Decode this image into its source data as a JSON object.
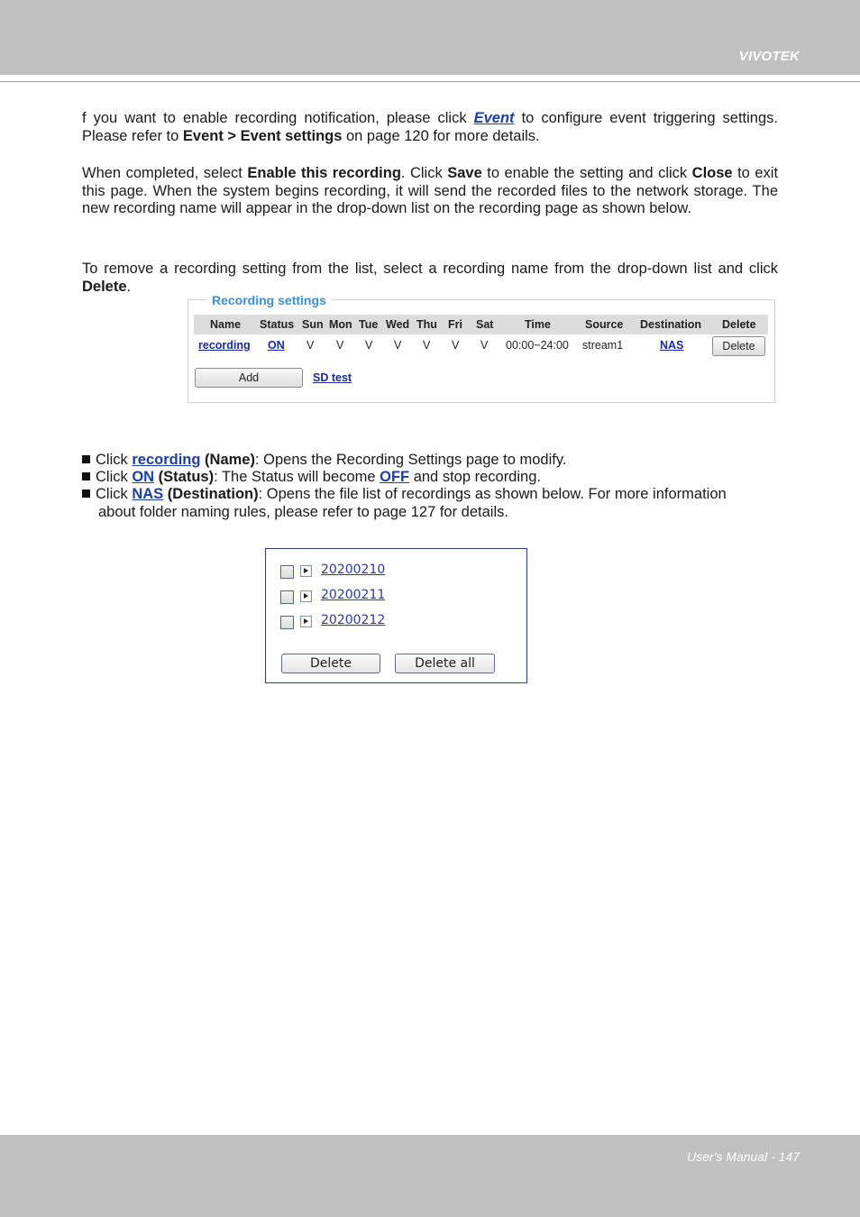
{
  "header": {
    "brand": "VIVOTEK"
  },
  "footer": {
    "text": "User's Manual - 147"
  },
  "paragraphs": {
    "p1": {
      "t1": "f you want to enable recording notification, please click ",
      "link": "Event",
      "t2": " to configure event triggering settings. Please refer to ",
      "b1": "Event > Event settings",
      "t3": " on page 120 for more details."
    },
    "p2": {
      "t1": "When completed, select ",
      "b1": "Enable this recording",
      "t2": ". Click ",
      "b2": "Save",
      "t3": " to enable the setting and click ",
      "b3": "Close",
      "t4": " to exit this page. When the system begins recording, it will send the recorded files to the network storage. The new recording name will appear in the drop-down list on the recording page as shown below."
    },
    "p3": {
      "t1": "To remove a recording setting from the list, select a recording name from the drop-down list and click ",
      "b1": "Delete",
      "t2": "."
    }
  },
  "recording_settings": {
    "legend": "Recording settings",
    "columns": [
      "Name",
      "Status",
      "Sun",
      "Mon",
      "Tue",
      "Wed",
      "Thu",
      "Fri",
      "Sat",
      "Time",
      "Source",
      "Destination",
      "Delete"
    ],
    "row": {
      "name": "recording",
      "status": "ON",
      "days": [
        "V",
        "V",
        "V",
        "V",
        "V",
        "V",
        "V"
      ],
      "time": "00:00~24:00",
      "source": "stream1",
      "destination": "NAS",
      "delete_label": "Delete"
    },
    "add_label": "Add",
    "sd_test_label": "SD test"
  },
  "bullets": [
    {
      "click": "Click ",
      "link": "recording",
      "bold": " (Name)",
      "text": ": Opens the Recording Settings page to modify."
    },
    {
      "click": "Click ",
      "link": "ON",
      "bold": " (Status)",
      "text": ": The Status will become ",
      "link2": "OFF",
      "text2": " and stop recording."
    },
    {
      "click": "Click ",
      "link": "NAS",
      "bold": " (Destination)",
      "text": ": Opens the file list of recordings as shown below. For more information",
      "text_cont": "about folder naming rules, please refer to page 127 for details."
    }
  ],
  "file_list": {
    "items": [
      "20200210",
      "20200211",
      "20200212"
    ],
    "delete_label": "Delete",
    "delete_all_label": "Delete all"
  }
}
